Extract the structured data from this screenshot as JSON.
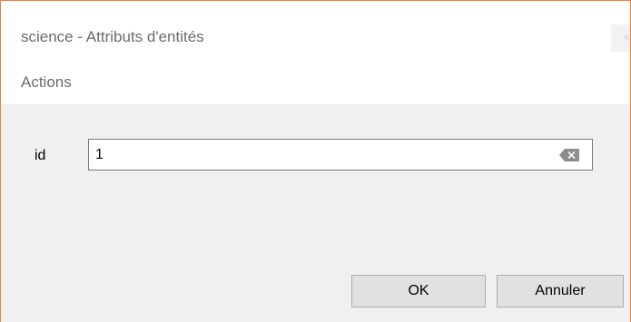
{
  "window": {
    "title": "science - Attributs d'entités",
    "close_glyph": "×"
  },
  "menu": {
    "items": [
      {
        "label": "Actions"
      }
    ]
  },
  "form": {
    "fields": [
      {
        "label": "id",
        "value": "1",
        "clear_icon": "clear-text-icon"
      }
    ]
  },
  "buttons": {
    "ok_label": "OK",
    "cancel_label": "Annuler"
  },
  "colors": {
    "window_border": "#e8823a",
    "content_background": "#f0f0f0",
    "button_background": "#e1e1e1"
  }
}
